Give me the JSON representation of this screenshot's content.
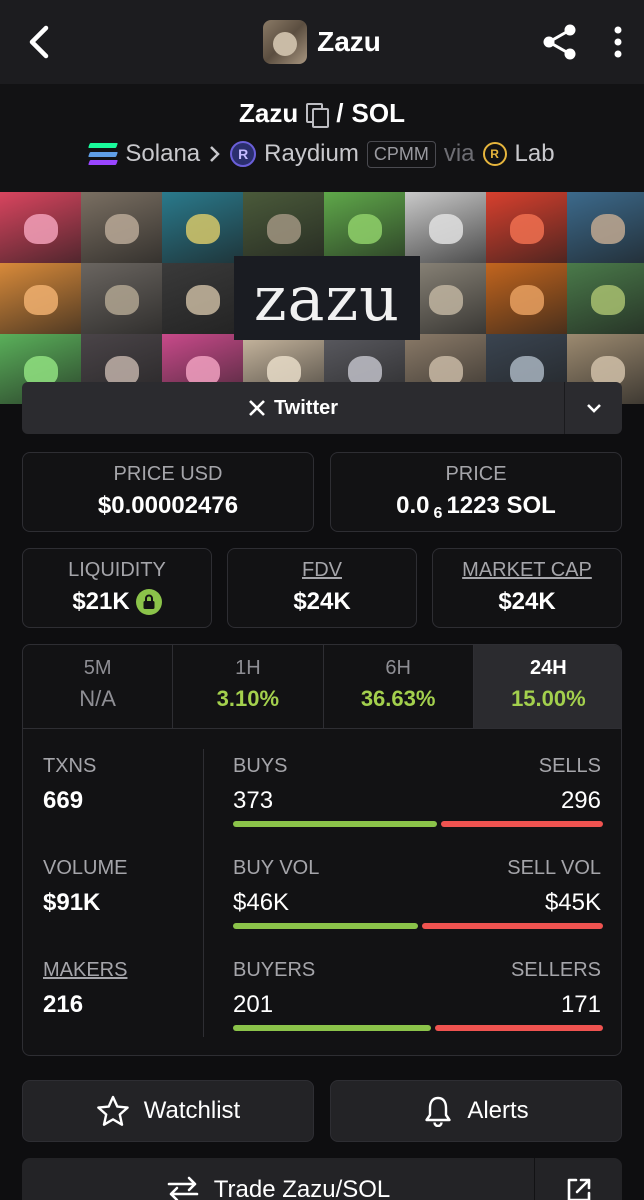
{
  "header": {
    "title": "Zazu"
  },
  "pair": {
    "base": "Zazu",
    "separator": "/",
    "quote": "SOL",
    "chain": "Solana",
    "dex": "Raydium",
    "pool_type": "CPMM",
    "via": "via",
    "launchpad": "Lab"
  },
  "banner": {
    "word": "zazu"
  },
  "social": {
    "twitter_label": "Twitter"
  },
  "price_usd": {
    "label": "PRICE USD",
    "value": "$0.00002476"
  },
  "price": {
    "label": "PRICE",
    "prefix": "0.0",
    "zeros": "6",
    "suffix": "1223 SOL"
  },
  "liquidity": {
    "label": "LIQUIDITY",
    "value": "$21K"
  },
  "fdv": {
    "label": "FDV",
    "value": "$24K"
  },
  "market_cap": {
    "label": "MARKET CAP",
    "value": "$24K"
  },
  "timeframes": [
    {
      "label": "5M",
      "value": "N/A"
    },
    {
      "label": "1H",
      "value": "3.10%"
    },
    {
      "label": "6H",
      "value": "36.63%"
    },
    {
      "label": "24H",
      "value": "15.00%"
    }
  ],
  "stats": {
    "txns": {
      "label": "TXNS",
      "value": "669"
    },
    "volume": {
      "label": "VOLUME",
      "value": "$91K"
    },
    "makers": {
      "label": "MAKERS",
      "value": "216"
    },
    "buys": {
      "label": "BUYS",
      "value": "373",
      "fraction": 0.558
    },
    "sells": {
      "label": "SELLS",
      "value": "296"
    },
    "buy_vol": {
      "label": "BUY VOL",
      "value": "$46K",
      "fraction": 0.505
    },
    "sell_vol": {
      "label": "SELL VOL",
      "value": "$45K"
    },
    "buyers": {
      "label": "BUYERS",
      "value": "201",
      "fraction": 0.54
    },
    "sellers": {
      "label": "SELLERS",
      "value": "171"
    }
  },
  "actions": {
    "watchlist": "Watchlist",
    "alerts": "Alerts",
    "trade": "Trade Zazu/SOL"
  },
  "colors": {
    "positive": "#a3d04d",
    "buy": "#8bc34a",
    "sell": "#ef5350"
  }
}
